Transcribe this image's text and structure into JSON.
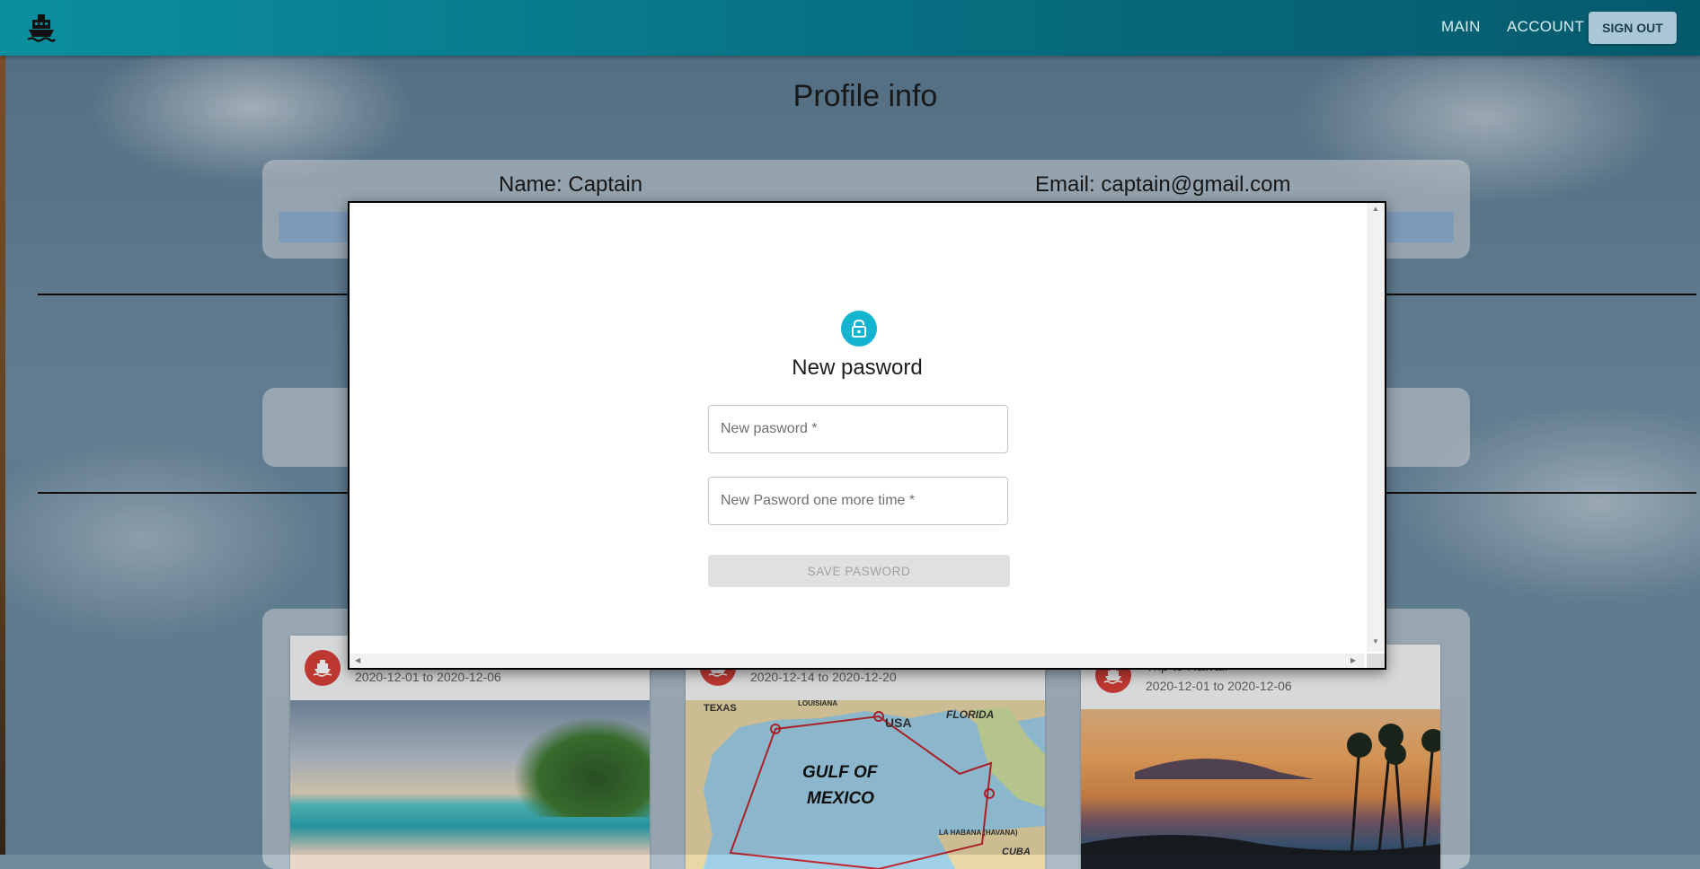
{
  "header": {
    "logo_icon": "ship-icon",
    "nav": {
      "main": "MAIN",
      "account": "ACCOUNT"
    },
    "sign_out": "SIGN OUT"
  },
  "profile": {
    "title": "Profile info",
    "name": "Name: Captain",
    "email": "Email: captain@gmail.com"
  },
  "trips": [
    {
      "title": "",
      "dates": "2020-12-01 to 2020-12-06",
      "icon": "ship-icon"
    },
    {
      "title": "",
      "dates": "2020-12-14 to 2020-12-20",
      "icon": "ship-icon",
      "map_labels": [
        "TEXAS",
        "LOUISIANA",
        "USA",
        "FLORIDA",
        "GULF OF",
        "MEXICO",
        "LA HABANA (HAVANA)",
        "CUBA"
      ]
    },
    {
      "title": "Trip to Hawaii",
      "dates": "2020-12-01 to 2020-12-06",
      "icon": "ship-icon"
    }
  ],
  "modal": {
    "icon": "lock-icon",
    "title": "New pasword",
    "password_placeholder": "New pasword *",
    "confirm_placeholder": "New Pasword one more time *",
    "save_label": "SAVE PASWORD"
  },
  "colors": {
    "header_start": "#0b8f9f",
    "header_end": "#055a6c",
    "accent_lock": "#14b3d0",
    "trip_avatar": "#d9403a"
  }
}
